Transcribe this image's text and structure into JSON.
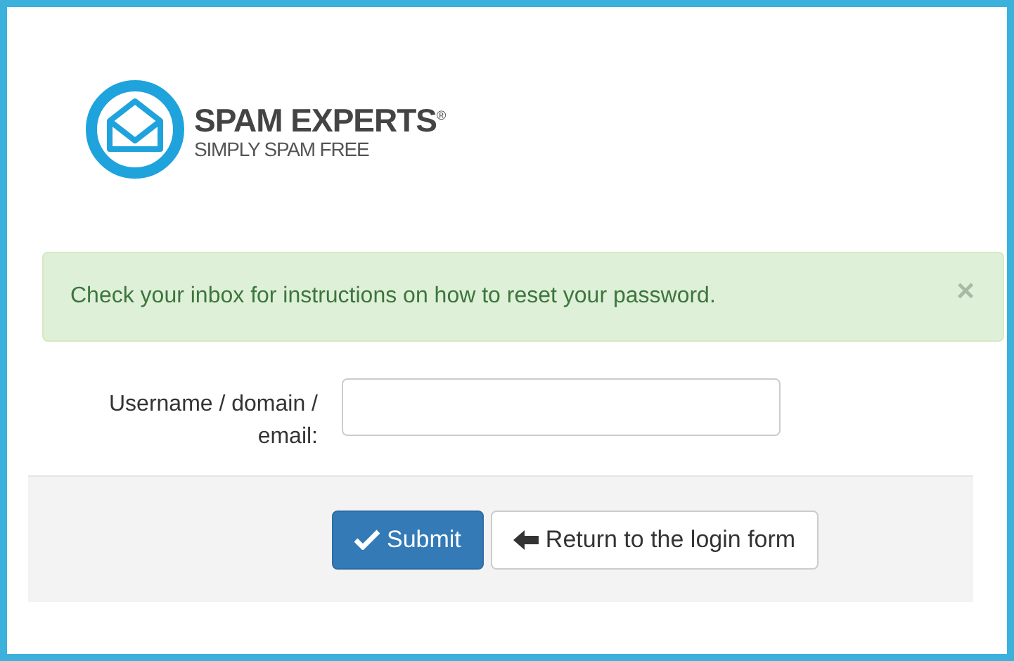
{
  "logo": {
    "name": "SPAM EXPERTS$^{®}$",
    "tagline": "SIMPLY SPAM FREE"
  },
  "alert": {
    "message": "Check your inbox for instructions on how to reset your password.",
    "close": "×"
  },
  "form": {
    "label": "Username / domain / email:"
  },
  "buttons": [
    {
      "kind": "primary",
      "label": "Submit"
    },
    {
      "kind": "default",
      "label": "Return to the login form"
    }
  ]
}
